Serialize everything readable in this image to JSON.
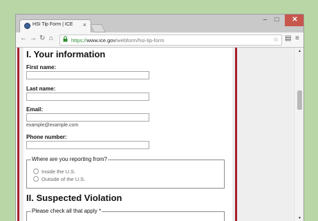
{
  "browser": {
    "tab_title": "HSI Tip Form | ICE",
    "tab_close": "×",
    "window_controls": {
      "minimize": "–",
      "maximize": "□",
      "close": "✕"
    },
    "nav": {
      "back": "←",
      "forward": "→",
      "reload": "↻",
      "home": "⌂"
    },
    "url": {
      "scheme": "https://",
      "host": "www.ice.gov",
      "path": "/webform/hsi-tip-form"
    },
    "icons": {
      "lock": "lock-icon",
      "star": "star-icon",
      "extension": "extension-icon",
      "menu": "menu-icon"
    },
    "scroll_arrows": {
      "up": "▲",
      "down": "▼"
    }
  },
  "form": {
    "section1_title": "I. Your information",
    "first_name_label": "First name:",
    "last_name_label": "Last name:",
    "email_label": "Email:",
    "email_hint": "example@example.com",
    "phone_label": "Phone number:",
    "reporting_legend": "Where are you reporting from?",
    "reporting_options": [
      "Inside the U.S.",
      "Outside of the U.S."
    ],
    "section2_title": "II. Suspected Violation",
    "violation_legend": "Please check all that apply *"
  },
  "colors": {
    "highlight": "#a8202e",
    "secure": "#2f8f31",
    "background": "#b9d7a6"
  }
}
